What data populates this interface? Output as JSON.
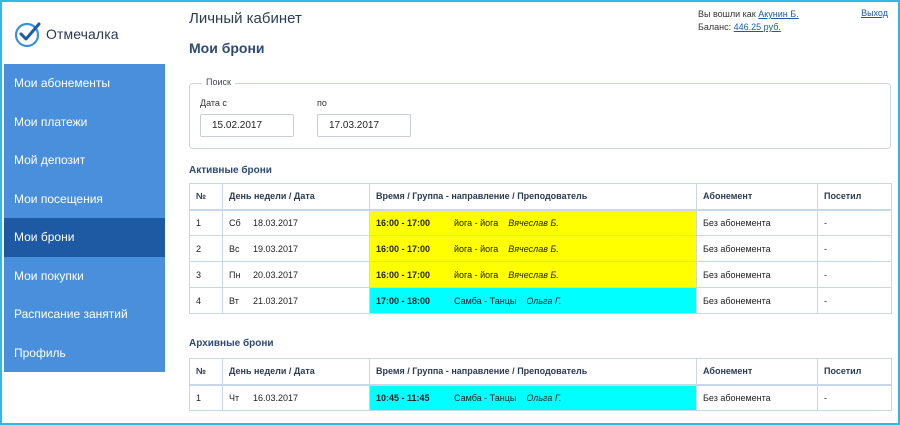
{
  "app": {
    "name": "Отмечалка"
  },
  "colors": {
    "sidebar": "#4a8fdb",
    "sidebar_active": "#1e5aa4",
    "border": "#2fb9e6",
    "highlight_yellow": "#ffff00",
    "highlight_cyan": "#00ffff"
  },
  "nav": [
    {
      "label": "Мои абонементы"
    },
    {
      "label": "Мои платежи"
    },
    {
      "label": "Мой депозит"
    },
    {
      "label": "Мои посещения"
    },
    {
      "label": "Мои брони"
    },
    {
      "label": "Мои покупки"
    },
    {
      "label": "Расписание занятий"
    },
    {
      "label": "Профиль"
    }
  ],
  "header": {
    "cabinet_title": "Личный кабинет",
    "page_title": "Мои брони",
    "logged_in_prefix": "Вы вошли как",
    "user_name": "Акунин Б.",
    "balance_prefix": "Баланс:",
    "balance_value": "446.25 руб.",
    "logout": "Выход"
  },
  "search": {
    "legend": "Поиск",
    "from_label": "Дата с",
    "from_value": "15.02.2017",
    "to_label": "по",
    "to_value": "17.03.2017"
  },
  "columns": {
    "num": "№",
    "day": "День недели / Дата",
    "time": "Время / Группа - направление / Преподователь",
    "ab": "Абонемент",
    "vis": "Посетил"
  },
  "active": {
    "title": "Активные брони",
    "rows": [
      {
        "num": "1",
        "dow": "Сб",
        "date": "18.03.2017",
        "time": "16:00 - 17:00",
        "group": "йога - йога",
        "trainer": "Вячеслав Б.",
        "ab": "Без абонемента",
        "vis": "-"
      },
      {
        "num": "2",
        "dow": "Вс",
        "date": "19.03.2017",
        "time": "16:00 - 17:00",
        "group": "йога - йога",
        "trainer": "Вячеслав Б.",
        "ab": "Без абонемента",
        "vis": "-"
      },
      {
        "num": "3",
        "dow": "Пн",
        "date": "20.03.2017",
        "time": "16:00 - 17:00",
        "group": "йога - йога",
        "trainer": "Вячеслав Б.",
        "ab": "Без абонемента",
        "vis": "-"
      },
      {
        "num": "4",
        "dow": "Вт",
        "date": "21.03.2017",
        "time": "17:00 - 18:00",
        "group": "Самба - Танцы",
        "trainer": "Ольга Г.",
        "ab": "Без абонемента",
        "vis": "-"
      }
    ]
  },
  "archive": {
    "title": "Архивные брони",
    "rows": [
      {
        "num": "1",
        "dow": "Чт",
        "date": "16.03.2017",
        "time": "10:45 - 11:45",
        "group": "Самба - Танцы",
        "trainer": "Ольга Г.",
        "ab": "Без абонемента",
        "vis": "-"
      }
    ]
  }
}
